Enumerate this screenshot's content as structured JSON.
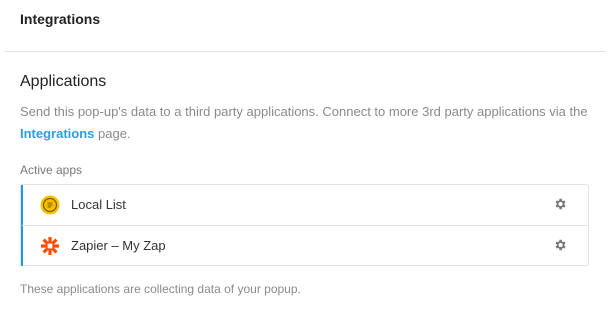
{
  "header": {
    "title": "Integrations"
  },
  "applications": {
    "title": "Applications",
    "description_prefix": "Send this pop-up's data to a third party applications. Connect to more 3rd party applications via the",
    "integrations_link": "Integrations",
    "description_suffix": "page.",
    "active_label": "Active apps",
    "apps": [
      {
        "name": "Local List",
        "icon": "local-list-icon"
      },
      {
        "name": "Zapier – My Zap",
        "icon": "zapier-icon"
      }
    ],
    "footer": "These applications are collecting data of your popup."
  },
  "colors": {
    "accent": "#1a9edb",
    "link": "#2e9cde",
    "local_list_icon": "#f2c200",
    "zapier_icon": "#ff4a00"
  }
}
